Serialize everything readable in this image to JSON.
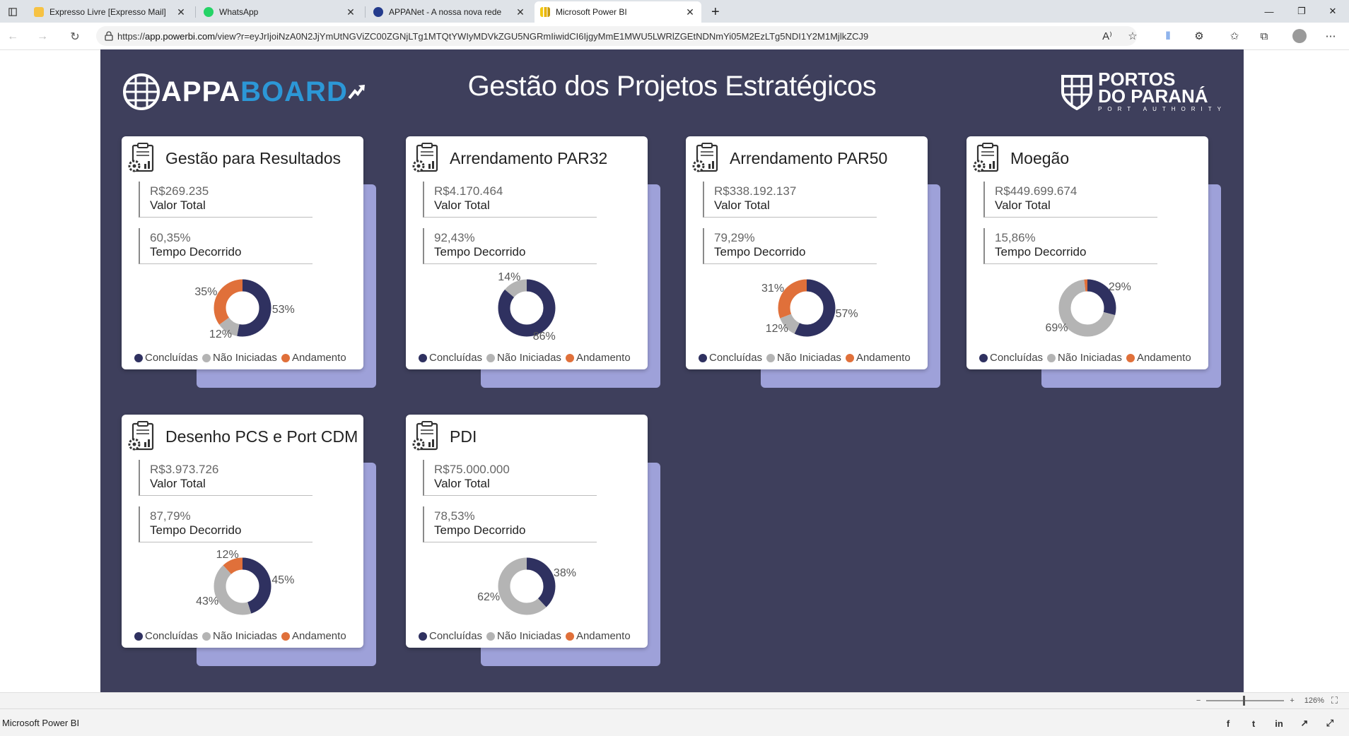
{
  "browser": {
    "tabs": [
      {
        "title": "Expresso Livre [Expresso Mail]",
        "icon": "expresso-icon",
        "active": false
      },
      {
        "title": "WhatsApp",
        "icon": "whatsapp-icon",
        "active": false
      },
      {
        "title": "APPANet - A nossa nova rede",
        "icon": "appanet-icon",
        "active": false
      },
      {
        "title": "Microsoft Power BI",
        "icon": "powerbi-icon",
        "active": true
      }
    ],
    "url_scheme": "https://",
    "url_host": "app.powerbi.com",
    "url_path": "/view?r=eyJrIjoiNzA0N2JjYmUtNGViZC00ZGNjLTg1MTQtYWIyMDVkZGU5NGRmIiwidCI6IjgyMmE1MWU5LWRlZGEtNDNmYi05M2EzLTg5NDI1Y2M1MjlkZCJ9"
  },
  "zoom": "126%",
  "footer": {
    "app_title": "Microsoft Power BI"
  },
  "report": {
    "logo_appa": "APPA",
    "logo_board": "BOARD",
    "title": "Gestão dos Projetos Estratégicos",
    "logo_portos_line1": "PORTOS",
    "logo_portos_line2": "DO PARANÁ",
    "logo_portos_sub": "PORT AUTHORITY",
    "valor_total_label": "Valor Total",
    "tempo_label": "Tempo Decorrido",
    "legend": [
      "Concluídas",
      "Não Iniciadas",
      "Andamento"
    ],
    "colors": {
      "concluidas": "#2f3160",
      "nao_iniciadas": "#b4b4b4",
      "andamento": "#e0703a",
      "canvas": "#3e3f5c",
      "shadow": "#9ea1d9"
    },
    "cards": [
      {
        "title": "Gestão para Resultados",
        "valor": "R$269.235",
        "tempo": "60,35%",
        "concluidas": 53,
        "nao_iniciadas": 12,
        "andamento": 35
      },
      {
        "title": "Arrendamento  PAR32",
        "valor": "R$4.170.464",
        "tempo": "92,43%",
        "concluidas": 86,
        "nao_iniciadas": 14,
        "andamento": 0
      },
      {
        "title": "Arrendamento  PAR50",
        "valor": "R$338.192.137",
        "tempo": "79,29%",
        "concluidas": 57,
        "nao_iniciadas": 12,
        "andamento": 31
      },
      {
        "title": "Moegão",
        "valor": "R$449.699.674",
        "tempo": "15,86%",
        "concluidas": 29,
        "nao_iniciadas": 69,
        "andamento": 2
      },
      {
        "title": "Desenho PCS e Port CDM",
        "valor": "R$3.973.726",
        "tempo": "87,79%",
        "concluidas": 45,
        "nao_iniciadas": 43,
        "andamento": 12
      },
      {
        "title": "PDI",
        "valor": "R$75.000.000",
        "tempo": "78,53%",
        "concluidas": 38,
        "nao_iniciadas": 62,
        "andamento": 0
      }
    ]
  }
}
